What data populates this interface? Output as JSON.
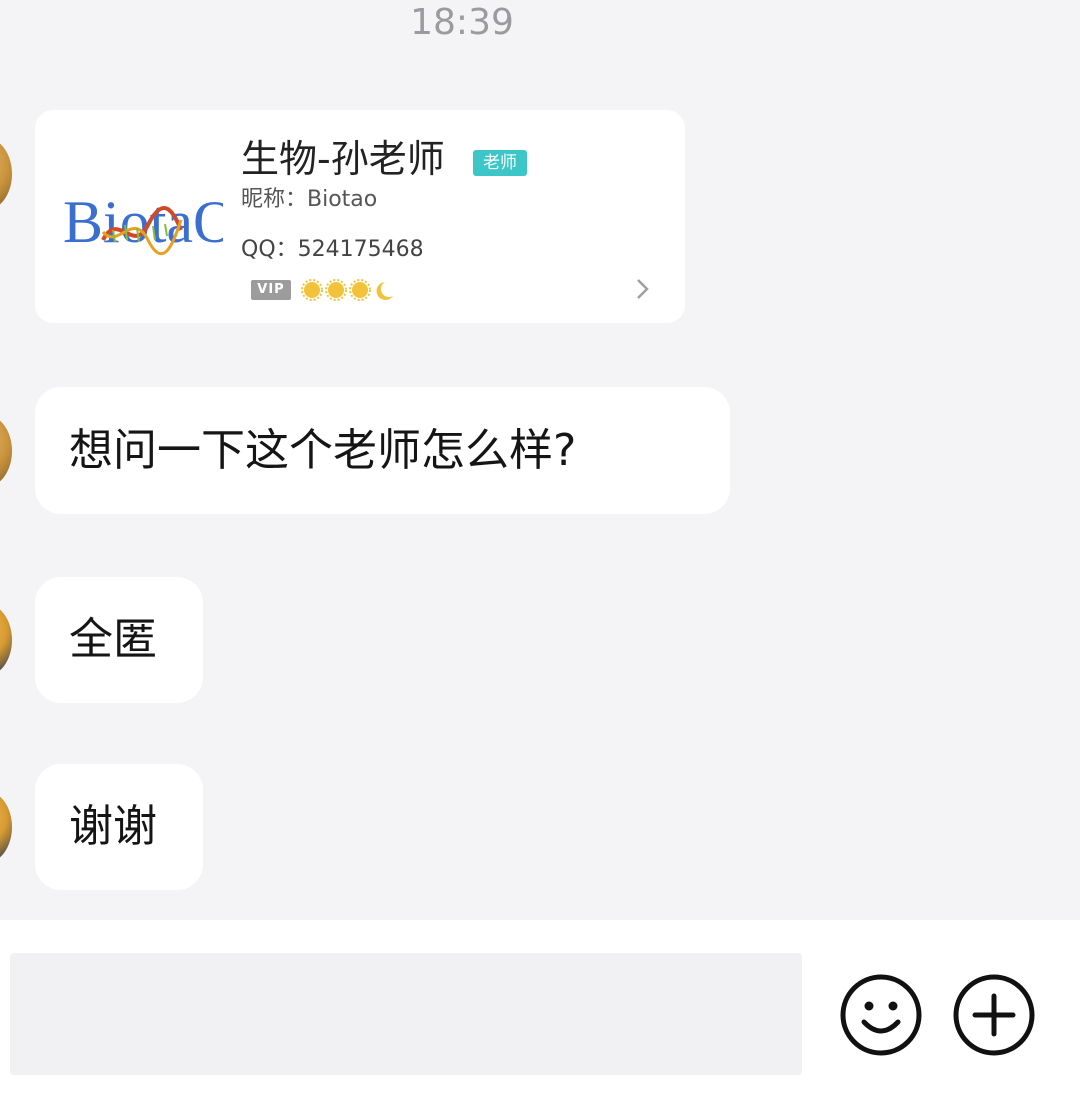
{
  "chat": {
    "timestamp": "18:39",
    "card": {
      "logo_text": "BiotaO",
      "name": "生物-孙老师",
      "role_badge": "老师",
      "nickname": "昵称：Biotao",
      "qq": "QQ：524175468",
      "vip_label": "VIP",
      "level_icons": [
        "sun-icon",
        "sun-icon",
        "sun-icon",
        "moon-icon"
      ],
      "accent_color": "#3cc6c8"
    },
    "messages": [
      {
        "text": "想问一下这个老师怎么样?"
      },
      {
        "text": "全匿"
      },
      {
        "text": "谢谢"
      }
    ]
  },
  "input_bar": {
    "value": "",
    "placeholder": "",
    "emoji_icon": "smiley-icon",
    "plus_icon": "plus-circle-icon"
  }
}
